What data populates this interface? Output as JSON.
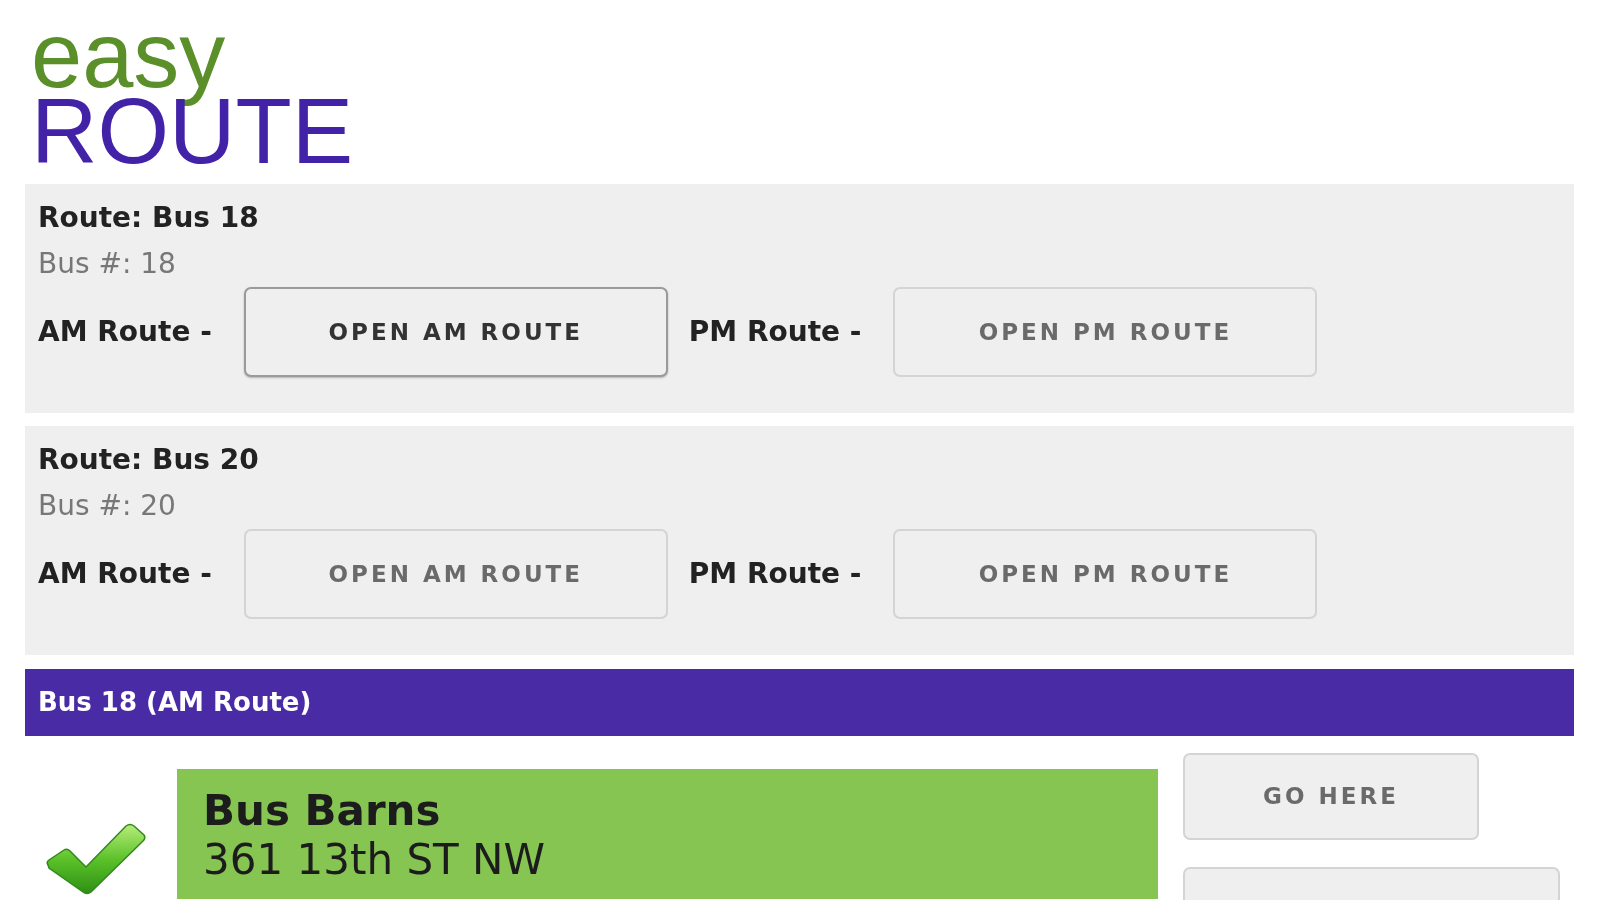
{
  "logo": {
    "word_1": "easy",
    "word_2": "ROUTE"
  },
  "routes": [
    {
      "title": "Route: Bus 18",
      "bus_number": "Bus #: 18",
      "am_label": "AM Route -",
      "am_button": {
        "label": "OPEN AM ROUTE",
        "selected": true
      },
      "pm_label": "PM Route -",
      "pm_button": {
        "label": "OPEN PM ROUTE",
        "selected": false
      }
    },
    {
      "title": "Route: Bus 20",
      "bus_number": "Bus #: 20",
      "am_label": "AM Route -",
      "am_button": {
        "label": "OPEN AM ROUTE",
        "selected": false
      },
      "pm_label": "PM Route -",
      "pm_button": {
        "label": "OPEN PM ROUTE",
        "selected": false
      }
    }
  ],
  "active_route": {
    "title": "Bus 18 (AM Route)",
    "stops": [
      {
        "name": "Bus Barns",
        "address": "361 13th ST NW",
        "visited": true,
        "actions": [
          "GO HERE"
        ]
      }
    ]
  }
}
